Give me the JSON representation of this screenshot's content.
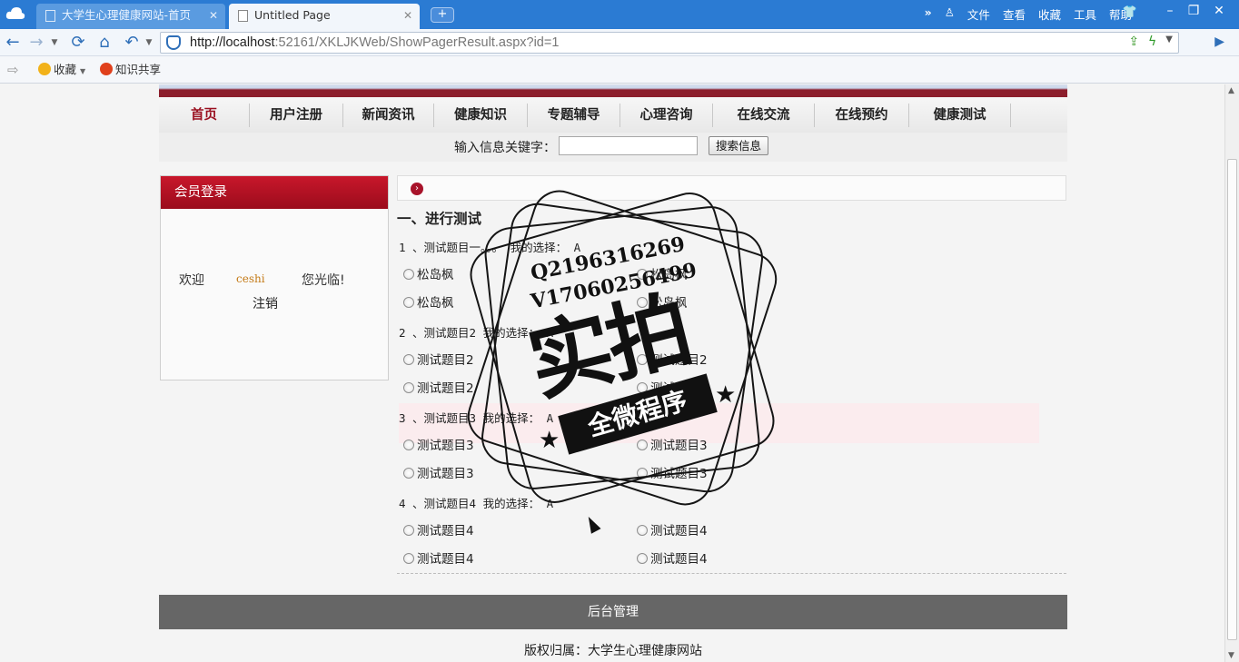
{
  "browser": {
    "tabs": [
      {
        "label": "大学生心理健康网站-首页"
      },
      {
        "label": "Untitled Page"
      }
    ],
    "menu": [
      "文件",
      "查看",
      "收藏",
      "工具",
      "帮助"
    ],
    "url_host": "http://localhost",
    "url_rest": ":52161/XKLJKWeb/ShowPagerResult.aspx?id=1",
    "favorites": [
      "收藏",
      "知识共享"
    ]
  },
  "nav": {
    "items": [
      "首页",
      "用户注册",
      "新闻资讯",
      "健康知识",
      "专题辅导",
      "心理咨询",
      "在线交流",
      "在线预约",
      "健康测试"
    ]
  },
  "search": {
    "label": "输入信息关键字：",
    "value": "",
    "button": "搜索信息"
  },
  "login": {
    "title": "会员登录",
    "welcome": "欢迎",
    "username": "ceshi",
    "greeting": "您光临!",
    "logout": "注销"
  },
  "test": {
    "section_title": "一、进行测试",
    "questions": [
      {
        "line": "1 、测试题目一。。。 我的选择： A",
        "options": [
          "松岛枫",
          "松岛枫",
          "松岛枫",
          "松岛枫"
        ]
      },
      {
        "line": "2 、测试题目2 我的选择： A",
        "options": [
          "测试题目2",
          "测试题目2",
          "测试题目2",
          "测试题目2"
        ]
      },
      {
        "line": "3 、测试题目3 我的选择： A",
        "options": [
          "测试题目3",
          "测试题目3",
          "测试题目3",
          "测试题目3"
        ]
      },
      {
        "line": "4 、测试题目4 我的选择： A",
        "options": [
          "测试题目4",
          "测试题目4",
          "测试题目4",
          "测试题目4"
        ]
      }
    ]
  },
  "footer": {
    "admin": "后台管理",
    "copyright": "版权归属：大学生心理健康网站"
  },
  "watermark": {
    "qq": "Q2196316269",
    "wechat": "V17060256499",
    "big": "实拍",
    "ribbon": "全微程序"
  },
  "colors": {
    "accent": "#9b0c1c",
    "browser_blue": "#2b7bd3"
  }
}
